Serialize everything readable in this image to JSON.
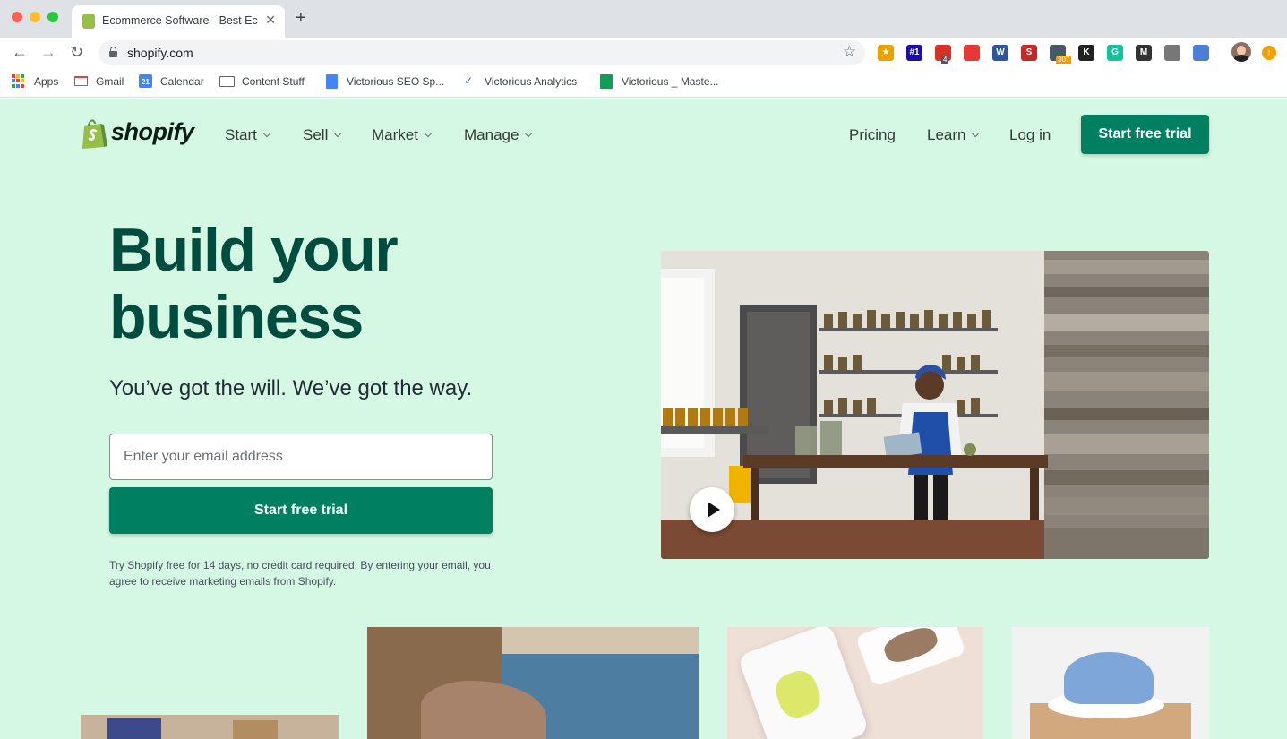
{
  "browser": {
    "tab_title": "Ecommerce Software - Best Ec",
    "tab_close": "✕",
    "new_tab": "+",
    "url": "shopify.com",
    "back": "←",
    "forward": "→",
    "reload": "↻",
    "star": "☆",
    "extensions": [
      {
        "name": "star-extension-icon",
        "label": "★",
        "color": "#e8a200"
      },
      {
        "name": "hashtag-extension-icon",
        "label": "#1",
        "color": "#1a0dab"
      },
      {
        "name": "calendar-extension-icon",
        "label": "",
        "badge": "4",
        "color": "#d93025"
      },
      {
        "name": "spiral-extension-icon",
        "label": "",
        "color": "#e53935"
      },
      {
        "name": "word-extension-icon",
        "label": "W",
        "color": "#2b579a"
      },
      {
        "name": "seo-extension-icon",
        "label": "S",
        "color": "#c62828"
      },
      {
        "name": "quill-extension-icon",
        "label": "",
        "badge": "307",
        "color": "#455a64"
      },
      {
        "name": "k-extension-icon",
        "label": "K",
        "color": "#222222"
      },
      {
        "name": "grammarly-extension-icon",
        "label": "G",
        "color": "#15c39a"
      },
      {
        "name": "m-extension-icon",
        "label": "M",
        "color": "#333333"
      },
      {
        "name": "gear-extension-icon",
        "label": "",
        "color": "#777777"
      },
      {
        "name": "reader-extension-icon",
        "label": "",
        "color": "#4a7fd4"
      }
    ],
    "bookmarks": [
      {
        "name": "bookmark-apps",
        "label": "Apps"
      },
      {
        "name": "bookmark-gmail",
        "label": "Gmail"
      },
      {
        "name": "bookmark-calendar",
        "label": "Calendar",
        "icon_text": "21"
      },
      {
        "name": "bookmark-content-stuff",
        "label": "Content Stuff"
      },
      {
        "name": "bookmark-victorious-seo",
        "label": "Victorious SEO Sp..."
      },
      {
        "name": "bookmark-victorious-analytics",
        "label": "Victorious Analytics"
      },
      {
        "name": "bookmark-victorious-master",
        "label": "Victorious _ Maste..."
      }
    ]
  },
  "nav": {
    "logo": "shopify",
    "items": [
      "Start",
      "Sell",
      "Market",
      "Manage"
    ],
    "pricing": "Pricing",
    "learn": "Learn",
    "login": "Log in",
    "cta": "Start free trial"
  },
  "hero": {
    "title_line1": "Build your",
    "title_line2": "business",
    "subtitle": "You’ve got the will. We’ve got the way.",
    "email_placeholder": "Enter your email address",
    "cta": "Start free trial",
    "disclaimer": "Try Shopify free for 14 days, no credit card required. By entering your email, you agree to receive marketing emails from Shopify."
  },
  "colors": {
    "page_bg": "#d5f8e4",
    "brand_green": "#008060",
    "title_green": "#004c3f",
    "logo_bag": "#95bf47"
  }
}
